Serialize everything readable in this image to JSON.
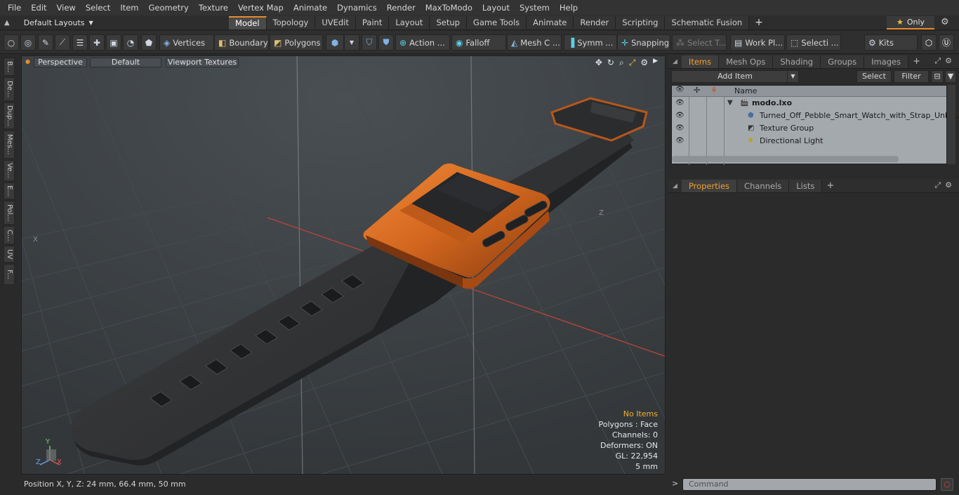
{
  "menu": [
    "File",
    "Edit",
    "View",
    "Select",
    "Item",
    "Geometry",
    "Texture",
    "Vertex Map",
    "Animate",
    "Dynamics",
    "Render",
    "MaxToModo",
    "Layout",
    "System",
    "Help"
  ],
  "layouts_label": "Default Layouts",
  "tabs": [
    "Model",
    "Topology",
    "UVEdit",
    "Paint",
    "Layout",
    "Setup",
    "Game Tools",
    "Animate",
    "Render",
    "Scripting",
    "Schematic Fusion"
  ],
  "only_label": "Only",
  "toolbar": {
    "vertices": "Vertices",
    "boundary": "Boundary",
    "polygons": "Polygons",
    "action": "Action ...",
    "falloff": "Falloff",
    "mesh": "Mesh C ...",
    "symm": "Symm ...",
    "snapping": "Snapping",
    "select_t": "Select T...",
    "work_pl": "Work Pl...",
    "selecti": "Selecti ...",
    "kits": "Kits"
  },
  "left_tabs": [
    "B...",
    "De...",
    "Dup...",
    "Mes...",
    "Ve...",
    "E...",
    "Pol...",
    "C...",
    "UV",
    "F..."
  ],
  "viewport": {
    "view_mode": "Perspective",
    "shading": "Default",
    "textures": "Viewport Textures",
    "axis_x": "X",
    "axis_z": "Z",
    "gizmo_y": "Y",
    "gizmo_z": "Z",
    "gizmo_x": "X",
    "info": {
      "no_items": "No Items",
      "polygons": "Polygons : Face",
      "channels": "Channels: 0",
      "deformers": "Deformers: ON",
      "gl": "GL: 22,954",
      "scale": "5 mm"
    }
  },
  "status": "Position X, Y, Z:   24 mm, 66.4 mm, 50 mm",
  "items_panel": {
    "tabs": [
      "Items",
      "Mesh Ops",
      "Shading",
      "Groups",
      "Images"
    ],
    "add_item": "Add Item",
    "select": "Select",
    "filter": "Filter",
    "name_header": "Name",
    "rows": [
      {
        "name": "modo.lxo",
        "bold": true
      },
      {
        "name": "Turned_Off_Pebble_Smart_Watch_with_Strap_Unb ..."
      },
      {
        "name": "Texture Group"
      },
      {
        "name": "Directional Light"
      }
    ]
  },
  "props_panel": {
    "tabs": [
      "Properties",
      "Channels",
      "Lists"
    ]
  },
  "command_placeholder": "Command",
  "colors": {
    "accent": "#e88b2b",
    "watch_case": "#d2661e",
    "strap": "#2e2f31",
    "viewport_bg": "#3c4043",
    "list_bg": "#a4a9ae"
  }
}
